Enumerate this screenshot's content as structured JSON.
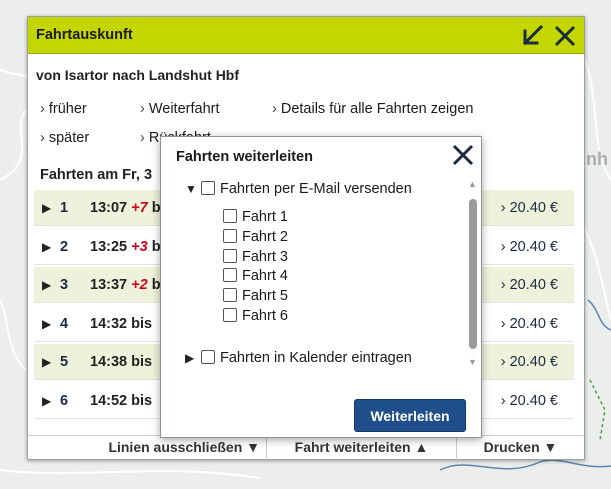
{
  "map": {
    "bg_label": "nh"
  },
  "panel": {
    "title": "Fahrtauskunft",
    "route": "von Isartor nach Landshut Hbf",
    "links": {
      "earlier": "früher",
      "later": "später",
      "onward": "Weiterfahrt",
      "return": "Rückfahrt",
      "details_all": "Details für alle Fahrten zeigen",
      "arrow": "›"
    },
    "date_label": "Fahrten am Fr, 3",
    "rows": [
      {
        "num": "1",
        "time": "13:07",
        "delay": "+7",
        "tail": "b",
        "price": "› 20.40 €"
      },
      {
        "num": "2",
        "time": "13:25",
        "delay": "+3",
        "tail": "b",
        "price": "› 20.40 €"
      },
      {
        "num": "3",
        "time": "13:37",
        "delay": "+2",
        "tail": "b",
        "price": "› 20.40 €"
      },
      {
        "num": "4",
        "time": "14:32 bis",
        "delay": "",
        "tail": "",
        "price": "› 20.40 €"
      },
      {
        "num": "5",
        "time": "14:38 bis",
        "delay": "",
        "tail": "",
        "price": "› 20.40 €"
      },
      {
        "num": "6",
        "time": "14:52 bis",
        "delay": "",
        "tail": "",
        "price": "› 20.40 €"
      }
    ],
    "footer": {
      "exclude_lines": "Linien ausschließen ▼",
      "forward_trip": "Fahrt weiterleiten ▲",
      "print": "Drucken ▼"
    }
  },
  "dialog": {
    "title": "Fahrten weiterleiten",
    "email_group": {
      "label": "Fahrten per E-Mail versenden",
      "expanded": true,
      "items": [
        "Fahrt 1",
        "Fahrt 2",
        "Fahrt 3",
        "Fahrt 4",
        "Fahrt 5",
        "Fahrt 6"
      ]
    },
    "calendar_group": {
      "label": "Fahrten in Kalender eintragen",
      "expanded": false
    },
    "submit_label": "Weiterleiten"
  },
  "colors": {
    "header_accent": "#c4d600",
    "row_highlight": "#eef2da",
    "delay_red": "#d0021b",
    "primary_button": "#1f4f8a",
    "icon_navy": "#1a2b44"
  }
}
